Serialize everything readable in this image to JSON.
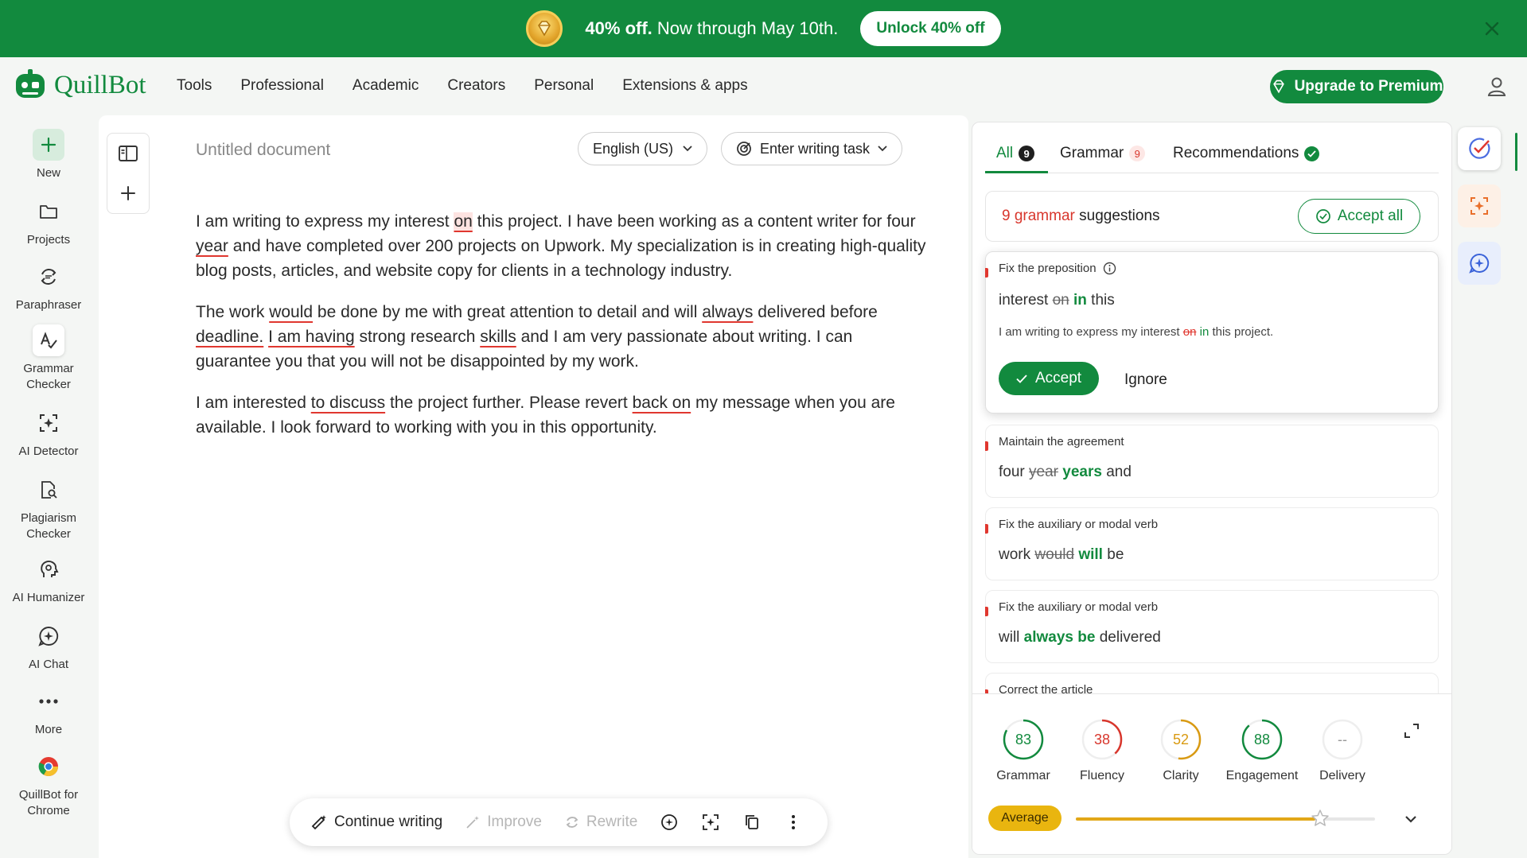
{
  "promo": {
    "text_bold": "40% off.",
    "text_rest": " Now through May 10th.",
    "button": "Unlock 40% off"
  },
  "brand": {
    "name": "QuillBot"
  },
  "nav": {
    "links": [
      "Tools",
      "Professional",
      "Academic",
      "Creators",
      "Personal",
      "Extensions & apps"
    ],
    "upgrade": "Upgrade to Premium"
  },
  "sidebar": {
    "items": [
      {
        "label": "New",
        "icon": "plus-icon"
      },
      {
        "label": "Projects",
        "icon": "folder-icon"
      },
      {
        "label": "Paraphraser",
        "icon": "paraphraser-icon"
      },
      {
        "label": "Grammar Checker",
        "icon": "grammar-icon"
      },
      {
        "label": "AI Detector",
        "icon": "ai-detector-icon"
      },
      {
        "label": "Plagiarism Checker",
        "icon": "plagiarism-icon"
      },
      {
        "label": "AI Humanizer",
        "icon": "humanizer-icon"
      },
      {
        "label": "AI Chat",
        "icon": "ai-chat-icon"
      },
      {
        "label": "More",
        "icon": "more-icon"
      },
      {
        "label": "QuillBot for Chrome",
        "icon": "chrome-icon"
      }
    ]
  },
  "editor": {
    "title": "Untitled document",
    "language": "English (US)",
    "task": "Enter writing task",
    "p1": {
      "a": "I am writing to express my interest ",
      "e1": "on",
      "b": " this project. I have been working as a content writer for four ",
      "e2": "year",
      "c": " and have completed over 200 projects on Upwork. My specialization is in creating high-quality blog posts, articles, and website copy for clients in a technology industry."
    },
    "p2": {
      "a": "The work ",
      "e1": "would",
      "b": " be done by me with great attention to detail and will ",
      "e2": "always",
      "c": " delivered before ",
      "e3": "deadline.",
      "d": " ",
      "e4": "I am having",
      "e": " strong research ",
      "e5": "skills",
      "f": " and I am very passionate about writing. I can guarantee you that you will not be disappointed by my work."
    },
    "p3": {
      "a": "I am interested ",
      "e1": "to discuss",
      "b": " the project further. Please revert ",
      "e2": "back on",
      "c": " my message when you are available. I look forward to working with you in this opportunity."
    },
    "bottom_bar": {
      "continue": "Continue writing",
      "improve": "Improve",
      "rewrite": "Rewrite"
    }
  },
  "panel": {
    "tabs": {
      "all": "All",
      "all_count": "9",
      "grammar": "Grammar",
      "grammar_count": "9",
      "recommendations": "Recommendations"
    },
    "summary": {
      "count_text": "9 grammar",
      "rest": " suggestions",
      "accept_all": "Accept all"
    },
    "active_card": {
      "title": "Fix the preposition",
      "before": "interest ",
      "wrong": "on",
      "fix": "in",
      "after": " this",
      "context_a": "I am writing to express my interest ",
      "context_wrong": "on",
      "context_fix": "in",
      "context_b": " this project.",
      "accept": "Accept",
      "ignore": "Ignore"
    },
    "cards": [
      {
        "title": "Maintain the agreement",
        "before": "four ",
        "wrong": "year",
        "fix": "years",
        "after": " and"
      },
      {
        "title": "Fix the auxiliary or modal verb",
        "before": "work ",
        "wrong": "would",
        "fix": "will",
        "after": " be"
      },
      {
        "title": "Fix the auxiliary or modal verb",
        "before": "will ",
        "wrong": "",
        "fix": "always be",
        "after": " delivered"
      },
      {
        "title": "Correct the article"
      }
    ],
    "scores": [
      {
        "label": "Grammar",
        "value": "83",
        "color": "#128a3e",
        "fraction": 0.83
      },
      {
        "label": "Fluency",
        "value": "38",
        "color": "#d8362c",
        "fraction": 0.38
      },
      {
        "label": "Clarity",
        "value": "52",
        "color": "#d99a12",
        "fraction": 0.52
      },
      {
        "label": "Engagement",
        "value": "88",
        "color": "#128a3e",
        "fraction": 0.88
      },
      {
        "label": "Delivery",
        "value": "--",
        "color": "#999999",
        "fraction": 0
      }
    ],
    "overall": {
      "label": "Average",
      "progress": 0.8
    }
  },
  "colors": {
    "brand": "#128a3e",
    "error": "#e0372f",
    "average": "#e9b50f"
  }
}
